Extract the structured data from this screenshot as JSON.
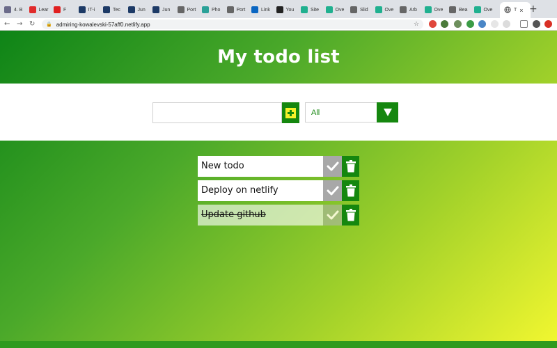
{
  "browser": {
    "tabs": [
      {
        "label": "4. B",
        "color": "#6b6b8a"
      },
      {
        "label": "Lear",
        "color": "#e02b2b"
      },
      {
        "label": "F",
        "color": "#e02020"
      },
      {
        "label": "IT-i",
        "color": "#1d3a66"
      },
      {
        "label": "Tec",
        "color": "#1d3a66"
      },
      {
        "label": "Jun",
        "color": "#1d3a66"
      },
      {
        "label": "Jun",
        "color": "#1d3a66"
      },
      {
        "label": "Port",
        "color": "#666666"
      },
      {
        "label": "Pho",
        "color": "#2aa198"
      },
      {
        "label": "Port",
        "color": "#666666"
      },
      {
        "label": "Link",
        "color": "#0a66c2"
      },
      {
        "label": "You",
        "color": "#222222"
      },
      {
        "label": "Site",
        "color": "#20b08f"
      },
      {
        "label": "Ove",
        "color": "#20b08f"
      },
      {
        "label": "Slid",
        "color": "#666666"
      },
      {
        "label": "Ove",
        "color": "#20b08f"
      },
      {
        "label": "Arb",
        "color": "#666666"
      },
      {
        "label": "Ove",
        "color": "#20b08f"
      },
      {
        "label": "Bea",
        "color": "#666666"
      },
      {
        "label": "Ove",
        "color": "#20b08f"
      }
    ],
    "active_tab": {
      "label": "T"
    },
    "url": "admiring-kowalevski-57aff0.netlify.app"
  },
  "page": {
    "title": "My todo list",
    "input": {
      "value": "",
      "placeholder": ""
    },
    "filter": {
      "selected": "All"
    },
    "todos": [
      {
        "text": "New todo",
        "completed": false
      },
      {
        "text": "Deploy on netlify",
        "completed": false
      },
      {
        "text": "Update github",
        "completed": true
      }
    ]
  },
  "colors": {
    "accent": "#15870f",
    "plus_fill": "#f5f02a",
    "gradient_start": "#0e8417",
    "gradient_end": "#f3f730"
  },
  "icons": {
    "add": "plus-square-icon",
    "dropdown": "caret-down-icon",
    "check": "check-icon",
    "delete": "trash-icon"
  }
}
